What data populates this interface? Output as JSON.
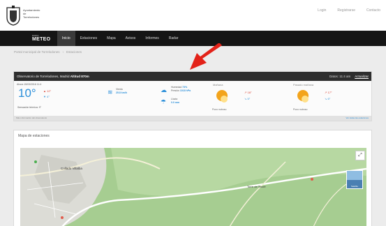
{
  "header": {
    "org_line1": "Ayuntamiento",
    "org_line2": "de",
    "org_line3": "Torrelodones",
    "links": [
      "Login",
      "Registrarse",
      "Contacto"
    ]
  },
  "nav": {
    "logo_small": "RADIO",
    "logo_big": "METEO",
    "items": [
      "Inicio",
      "Estaciones",
      "Mapa",
      "Avisos",
      "Informes",
      "Radar"
    ],
    "active": "Inicio"
  },
  "breadcrumb": {
    "items": [
      "Portal municipal de Torrelodones",
      "Estaciones"
    ]
  },
  "weather": {
    "location_prefix": "Observatorio de Torrelodones, Madrid",
    "location_bold": "Altitud 870m",
    "updated": "Datos: 11:4 am",
    "updated_link": "Actualizar",
    "now_label": "Ahora 15/03/2016 11:4",
    "temp": "10°",
    "max": "12°",
    "min": "4°",
    "feels": "Sensación térmica: 9°",
    "wind_label": "Viento",
    "wind_value": "25.8 km/h",
    "humidity_label": "Humedad",
    "humidity_value": "73%",
    "pressure_label": "Presión",
    "pressure_value": "1018 hPa",
    "rain_label": "Lluvia",
    "rain_value": "0.0 mm",
    "forecast": [
      {
        "title": "Mañana",
        "hi": "16°",
        "lo": "5°",
        "desc": "Poco nuboso"
      },
      {
        "title": "Pasado mañana",
        "hi": "17°",
        "lo": "6°",
        "desc": "Poco nuboso"
      }
    ],
    "source": "Más información del observatorio",
    "more": "Ver todas las estaciones"
  },
  "map": {
    "title": "Mapa de estaciones",
    "labels": [
      "Collado Villalba",
      "Torre de Tercer"
    ],
    "thumb_label": "Satélite"
  },
  "colors": {
    "accent_blue": "#2b8fd9",
    "hot_red": "#d83a2a",
    "nav_bg": "#151515",
    "map_green": "#a6cd91",
    "arrow_red": "#e32219"
  }
}
